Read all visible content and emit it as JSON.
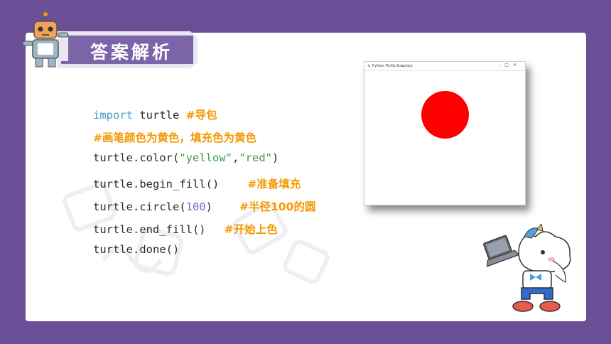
{
  "header": {
    "title": "答案解析"
  },
  "code": {
    "line1": {
      "keyword": "import",
      "rest": " turtle ",
      "comment": "#导包"
    },
    "line2": {
      "comment": "#画笔颜色为黄色，填充色为黄色"
    },
    "line3": {
      "pre": "turtle.color(",
      "arg1": "\"yellow\"",
      "sep": ",",
      "arg2": "\"red\"",
      "post": ")"
    },
    "line4": {
      "code": "turtle.begin_fill()",
      "comment": "#准备填充"
    },
    "line5": {
      "pre": "turtle.circle(",
      "arg": "100",
      "post": ")",
      "comment": "#半径100的圆"
    },
    "line6": {
      "code": "turtle.end_fill()",
      "comment": "#开始上色"
    },
    "line7": {
      "code": "turtle.done()"
    }
  },
  "window": {
    "title": "Python Turtle Graphics",
    "controls": {
      "minimize": "–",
      "maximize": "□",
      "close": "×"
    },
    "fill_color": "#ff0000"
  },
  "colors": {
    "background": "#6a4f96",
    "accent_tab": "#7c64a8",
    "comment": "#f39800",
    "keyword": "#4a97c8",
    "string": "#3a9a46",
    "number": "#7a6ac9"
  }
}
